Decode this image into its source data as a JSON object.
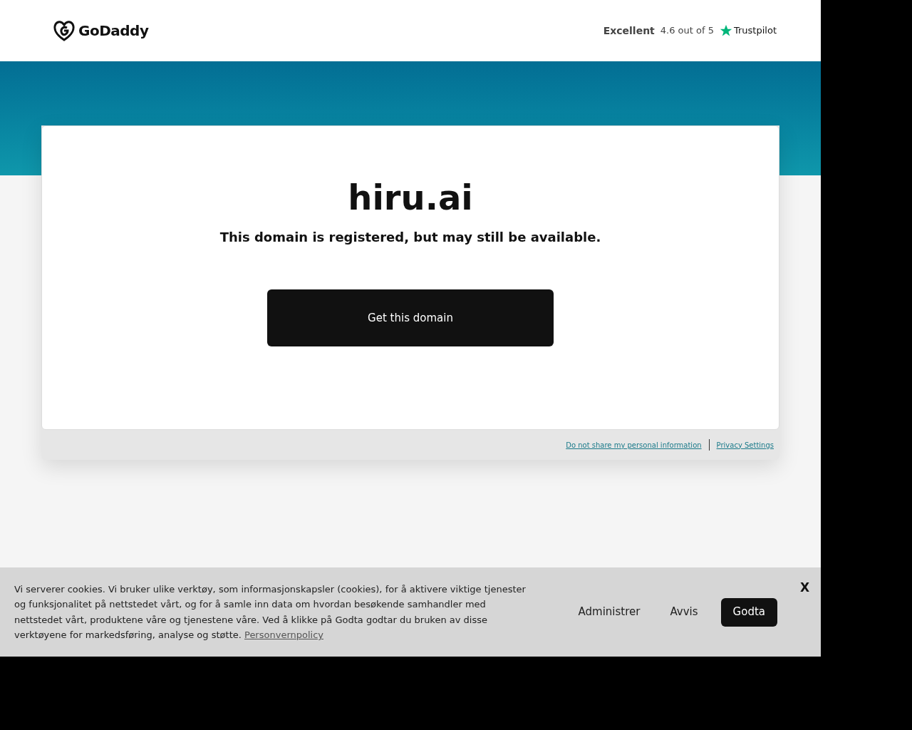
{
  "header": {
    "logo": "GoDaddy",
    "rating_label": "Excellent",
    "rating_score": "4.6 out of 5",
    "rating_brand": "Trustpilot"
  },
  "card": {
    "domain": "hiru.ai",
    "message": "This domain is registered, but may still be available.",
    "button": "Get this domain"
  },
  "footer_links": [
    "Do not share my personal information",
    "Privacy Settings"
  ],
  "cookie_banner": {
    "text": "Vi serverer cookies. Vi bruker ulike verktøy, som informasjonskapsler (cookies), for å aktivere viktige tjenester og funksjonalitet på nettstedet vårt, og for å samle inn data om hvordan besøkende samhandler med nettstedet vårt, produktene våre og tjenestene våre. Ved å klikke på Godta godtar du bruken av disse verktøyene for markedsføring, analyse og støtte.",
    "policy_link": "Personvernpolicy",
    "buttons": [
      {
        "label": "Administrer",
        "kind": "plain"
      },
      {
        "label": "Avvis",
        "kind": "plain"
      },
      {
        "label": "Godta",
        "kind": "primary"
      }
    ],
    "close": "X"
  }
}
